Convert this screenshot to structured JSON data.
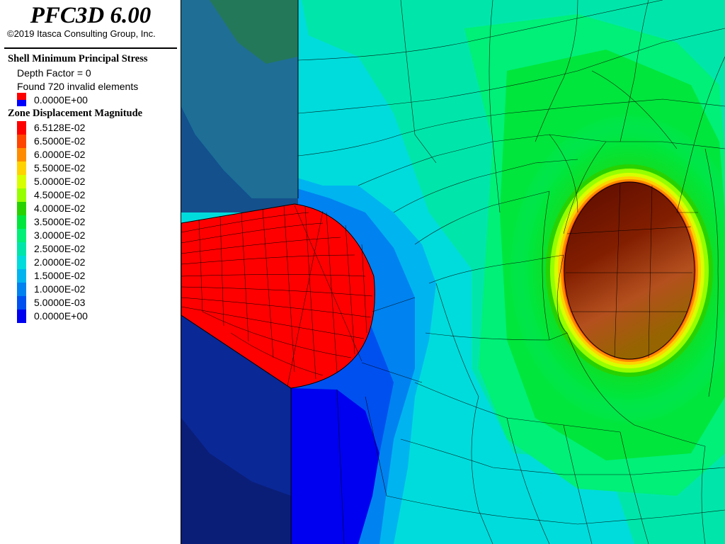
{
  "app": {
    "title": "PFC3D 6.00",
    "copyright": "©2019 Itasca Consulting Group, Inc."
  },
  "shell_stress": {
    "title": "Shell Minimum Principal Stress",
    "depth_factor": "Depth Factor = 0",
    "invalid": "Found 720 invalid elements",
    "swatch_colors": [
      "#ff0000",
      "#0000ff"
    ],
    "value": "0.0000E+00"
  },
  "zone_displacement": {
    "title": "Zone Displacement Magnitude",
    "entries": [
      {
        "label": "6.5128E-02",
        "color": "#ff0000"
      },
      {
        "label": "6.5000E-02",
        "color": "#ff4500"
      },
      {
        "label": "6.0000E-02",
        "color": "#ff8c00"
      },
      {
        "label": "5.5000E-02",
        "color": "#ffd200"
      },
      {
        "label": "5.0000E-02",
        "color": "#d8ff00"
      },
      {
        "label": "4.5000E-02",
        "color": "#96ff00"
      },
      {
        "label": "4.0000E-02",
        "color": "#28d200"
      },
      {
        "label": "3.5000E-02",
        "color": "#00e63c"
      },
      {
        "label": "3.0000E-02",
        "color": "#00f078"
      },
      {
        "label": "2.5000E-02",
        "color": "#00e6aa"
      },
      {
        "label": "2.0000E-02",
        "color": "#00dcdc"
      },
      {
        "label": "1.5000E-02",
        "color": "#00b4f0"
      },
      {
        "label": "1.0000E-02",
        "color": "#0082f0"
      },
      {
        "label": "5.0000E-03",
        "color": "#0050f0"
      },
      {
        "label": "0.0000E+00",
        "color": "#0000f0"
      }
    ]
  },
  "colors": {
    "shell_fill": "#ff0000",
    "cavity_dark": "#641400"
  }
}
